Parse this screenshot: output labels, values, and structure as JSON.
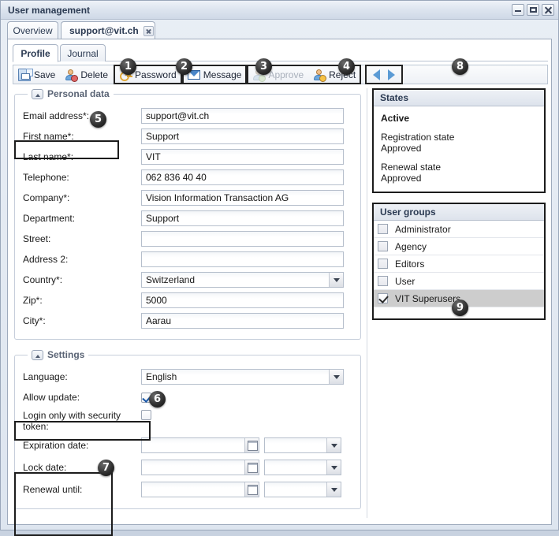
{
  "window": {
    "title": "User management",
    "buttons": {
      "minimize": "minimize",
      "maximize": "maximize",
      "close": "close"
    }
  },
  "outer_tabs": [
    {
      "label": "Overview",
      "active": false,
      "closable": false
    },
    {
      "label": "support@vit.ch",
      "active": true,
      "closable": true
    }
  ],
  "inner_tabs": [
    {
      "label": "Profile",
      "active": true
    },
    {
      "label": "Journal",
      "active": false
    }
  ],
  "toolbar": {
    "save": "Save",
    "delete": "Delete",
    "password": "Password",
    "message": "Message",
    "approve": "Approve",
    "reject": "Reject",
    "nav_prev": "previous",
    "nav_next": "next"
  },
  "callouts": {
    "c1": "1",
    "c2": "2",
    "c3": "3",
    "c4": "4",
    "c5": "5",
    "c6": "6",
    "c7": "7",
    "c8": "8",
    "c9": "9"
  },
  "personal_data": {
    "legend": "Personal data",
    "fields": [
      {
        "label": "Email address*:",
        "value": "support@vit.ch",
        "type": "text"
      },
      {
        "label": "First name*:",
        "value": "Support",
        "type": "text"
      },
      {
        "label": "Last name*:",
        "value": "VIT",
        "type": "text"
      },
      {
        "label": "Telephone:",
        "value": "062 836 40 40",
        "type": "text"
      },
      {
        "label": "Company*:",
        "value": "Vision Information Transaction AG",
        "type": "text"
      },
      {
        "label": "Department:",
        "value": "Support",
        "type": "text"
      },
      {
        "label": "Street:",
        "value": "",
        "type": "text"
      },
      {
        "label": "Address 2:",
        "value": "",
        "type": "text"
      },
      {
        "label": "Country*:",
        "value": "Switzerland",
        "type": "select"
      },
      {
        "label": "Zip*:",
        "value": "5000",
        "type": "text"
      },
      {
        "label": "City*:",
        "value": "Aarau",
        "type": "text"
      }
    ]
  },
  "settings": {
    "legend": "Settings",
    "language_label": "Language:",
    "language_value": "English",
    "allow_update_label": "Allow update:",
    "allow_update_checked": true,
    "security_token_label": "Login only with security token:",
    "security_token_checked": false,
    "date_rows": [
      {
        "label": "Expiration date:",
        "date_value": "",
        "time_value": ""
      },
      {
        "label": "Lock date:",
        "date_value": "",
        "time_value": ""
      },
      {
        "label": "Renewal until:",
        "date_value": "",
        "time_value": ""
      }
    ]
  },
  "states": {
    "title": "States",
    "active": "Active",
    "registration_label": "Registration state",
    "registration_value": "Approved",
    "renewal_label": "Renewal state",
    "renewal_value": "Approved"
  },
  "user_groups": {
    "title": "User groups",
    "rows": [
      {
        "label": "Administrator",
        "checked": false,
        "selected": false
      },
      {
        "label": "Agency",
        "checked": false,
        "selected": false
      },
      {
        "label": "Editors",
        "checked": false,
        "selected": false
      },
      {
        "label": "User",
        "checked": false,
        "selected": false
      },
      {
        "label": "VIT Superusers",
        "checked": true,
        "selected": true
      }
    ]
  },
  "colors": {
    "accent": "#5b9bd5",
    "title_text": "#2b3a52",
    "highlight_outline": "#1c1c1c",
    "selected_row": "#cdcdcd"
  }
}
